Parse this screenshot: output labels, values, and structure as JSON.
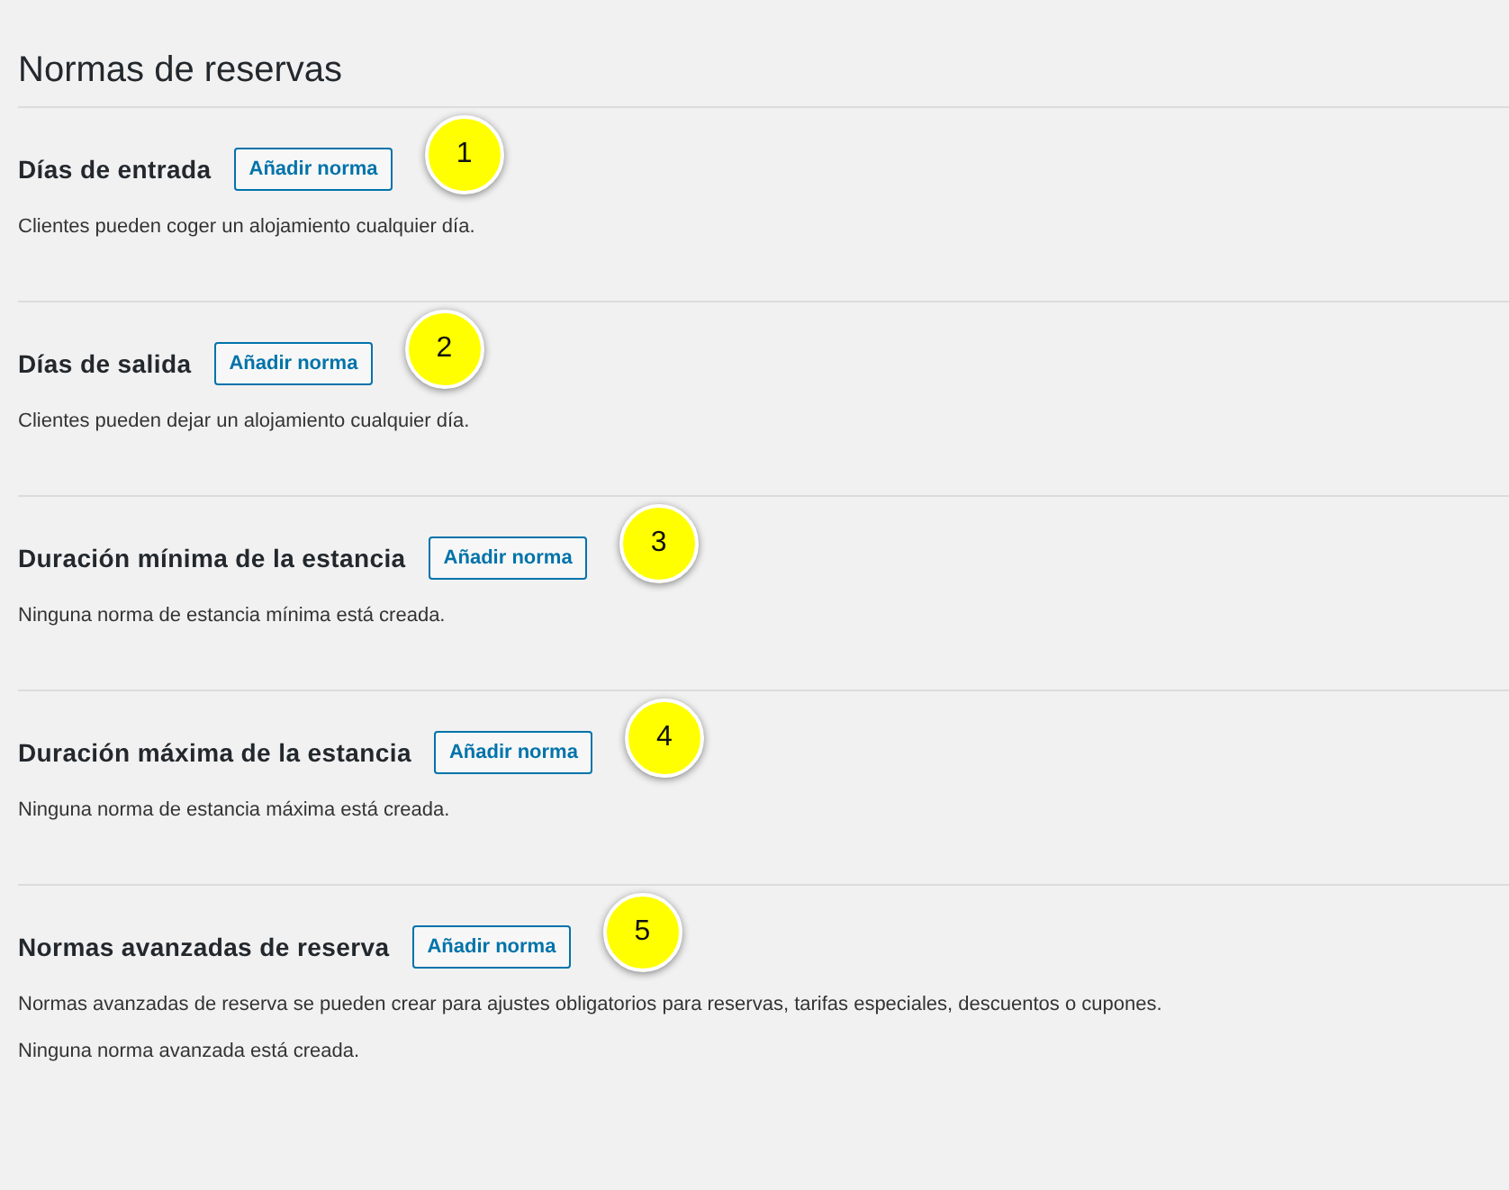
{
  "page": {
    "title": "Normas de reservas"
  },
  "sections": [
    {
      "heading": "Días de entrada",
      "button": "Añadir norma",
      "callout": "1",
      "paragraphs": [
        "Clientes pueden coger un alojamiento cualquier día."
      ]
    },
    {
      "heading": "Días de salida",
      "button": "Añadir norma",
      "callout": "2",
      "paragraphs": [
        "Clientes pueden dejar un alojamiento cualquier día."
      ]
    },
    {
      "heading": "Duración mínima de la estancia",
      "button": "Añadir norma",
      "callout": "3",
      "paragraphs": [
        "Ninguna norma de estancia mínima está creada."
      ]
    },
    {
      "heading": "Duración máxima de la estancia",
      "button": "Añadir norma",
      "callout": "4",
      "paragraphs": [
        "Ninguna norma de estancia máxima está creada."
      ]
    },
    {
      "heading": "Normas avanzadas de reserva",
      "button": "Añadir norma",
      "callout": "5",
      "paragraphs": [
        "Normas avanzadas de reserva se pueden crear para ajustes obligatorios para reservas, tarifas especiales, descuentos o cupones.",
        "Ninguna norma avanzada está creada."
      ]
    }
  ]
}
